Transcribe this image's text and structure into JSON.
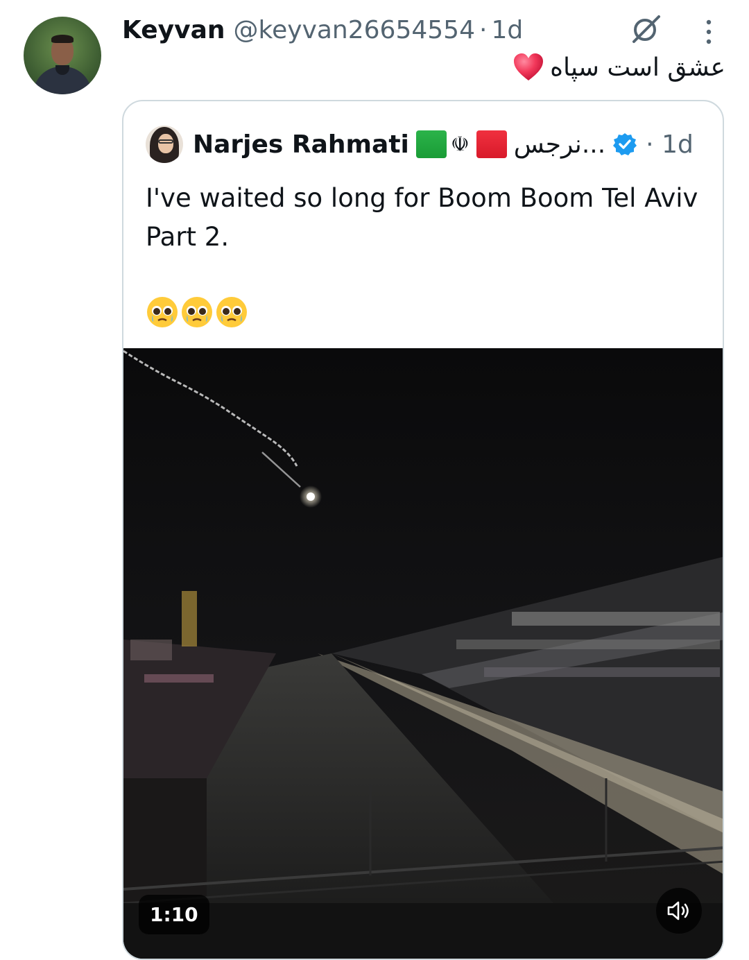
{
  "tweet": {
    "author_name": "Keyvan",
    "author_handle": "@keyvan26654554",
    "separator": "·",
    "time": "1d",
    "text": "عشق است سپاه"
  },
  "quote": {
    "author_name": "Narjes Rahmati",
    "author_name_rtl": "...نرجس",
    "separator": "·",
    "time": "1d",
    "text": "I've waited so long for Boom Boom Tel Aviv Part 2.",
    "emoji_count": 3,
    "video": {
      "duration": "1:10"
    }
  },
  "icons": {
    "grok": "grok-icon",
    "more": "more-vertical-icon",
    "heart": "red-heart-emoji",
    "verified": "verified-badge-icon",
    "sound": "volume-icon"
  },
  "colors": {
    "text": "#0f1419",
    "secondary": "#536471",
    "border": "#cfd9de",
    "verified": "#1d9bf0"
  }
}
